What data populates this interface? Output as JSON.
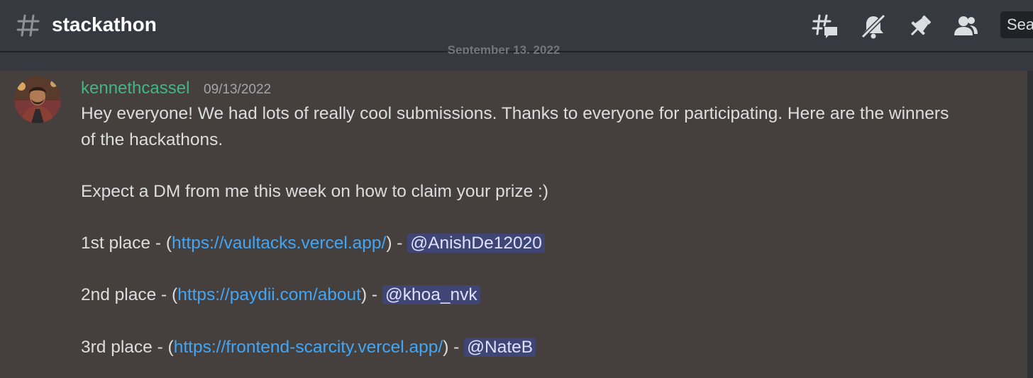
{
  "header": {
    "channel_name": "stackathon",
    "icons": [
      "threads-icon",
      "mute-notifications-icon",
      "pin-icon",
      "members-icon"
    ],
    "search_label": "Sea"
  },
  "divider": {
    "date": "September 13, 2022"
  },
  "message": {
    "username": "kennethcassel",
    "username_color": "#43b581",
    "timestamp": "09/13/2022",
    "line1": "Hey everyone! We had lots of really cool submissions. Thanks to everyone for participating. Here are the winners",
    "line2": "of the hackathons.",
    "line3": "Expect a DM from me this week on how to claim your prize :)",
    "winners": [
      {
        "prefix": "1st place - (",
        "url": "https://vaultacks.vercel.app/",
        "mid": ") - ",
        "mention": "@AnishDe12020"
      },
      {
        "prefix": "2nd place - (",
        "url": "https://paydii.com/about",
        "mid": ") - ",
        "mention": "@khoa_nvk"
      },
      {
        "prefix": "3rd place - (",
        "url": "https://frontend-scarcity.vercel.app/",
        "mid": ") - ",
        "mention": "@NateB"
      }
    ]
  },
  "colors": {
    "background": "#36393f",
    "message_highlight": "#45403d",
    "link": "#42a5f5",
    "mention_bg": "#3f4676"
  }
}
